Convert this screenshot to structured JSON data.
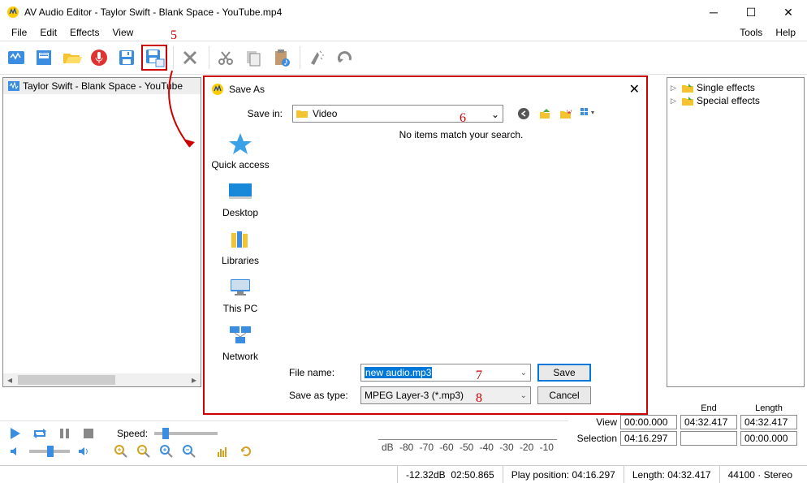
{
  "window": {
    "title": "AV Audio Editor - Taylor Swift - Blank Space - YouTube.mp4"
  },
  "menu": {
    "file": "File",
    "edit": "Edit",
    "effects": "Effects",
    "view": "View",
    "tools": "Tools",
    "help": "Help"
  },
  "left_panel": {
    "item": "Taylor Swift - Blank Space - YouTube"
  },
  "right_panel": {
    "single": "Single effects",
    "special": "Special effects"
  },
  "dialog": {
    "title": "Save As",
    "savein_label": "Save in:",
    "savein_value": "Video",
    "empty_msg": "No items match your search.",
    "places": {
      "quick": "Quick access",
      "desktop": "Desktop",
      "libraries": "Libraries",
      "thispc": "This PC",
      "network": "Network"
    },
    "filename_label": "File name:",
    "filename_value": "new audio.mp3",
    "saveastype_label": "Save as type:",
    "saveastype_value": "MPEG Layer-3 (*.mp3)",
    "save_btn": "Save",
    "cancel_btn": "Cancel"
  },
  "controls": {
    "speed_label": "Speed:"
  },
  "ruler": {
    "db": "dB",
    "ticks": [
      "-80",
      "-70",
      "-60",
      "-50",
      "-40",
      "-30",
      "-20",
      "-10"
    ]
  },
  "info": {
    "end_label": "End",
    "length_label": "Length",
    "view_label": "View",
    "view_start": "00:00.000",
    "view_end": "04:32.417",
    "view_len": "04:32.417",
    "sel_label": "Selection",
    "sel_start": "04:16.297",
    "sel_end": "",
    "sel_len": "00:00.000"
  },
  "status": {
    "db": "-12.32dB",
    "time": "02:50.865",
    "playpos": "Play position: 04:16.297",
    "length": "Length: 04:32.417",
    "rate": "44100",
    "channels": "Stereo"
  },
  "annotations": {
    "a5": "5",
    "a6": "6",
    "a7": "7",
    "a8": "8"
  }
}
